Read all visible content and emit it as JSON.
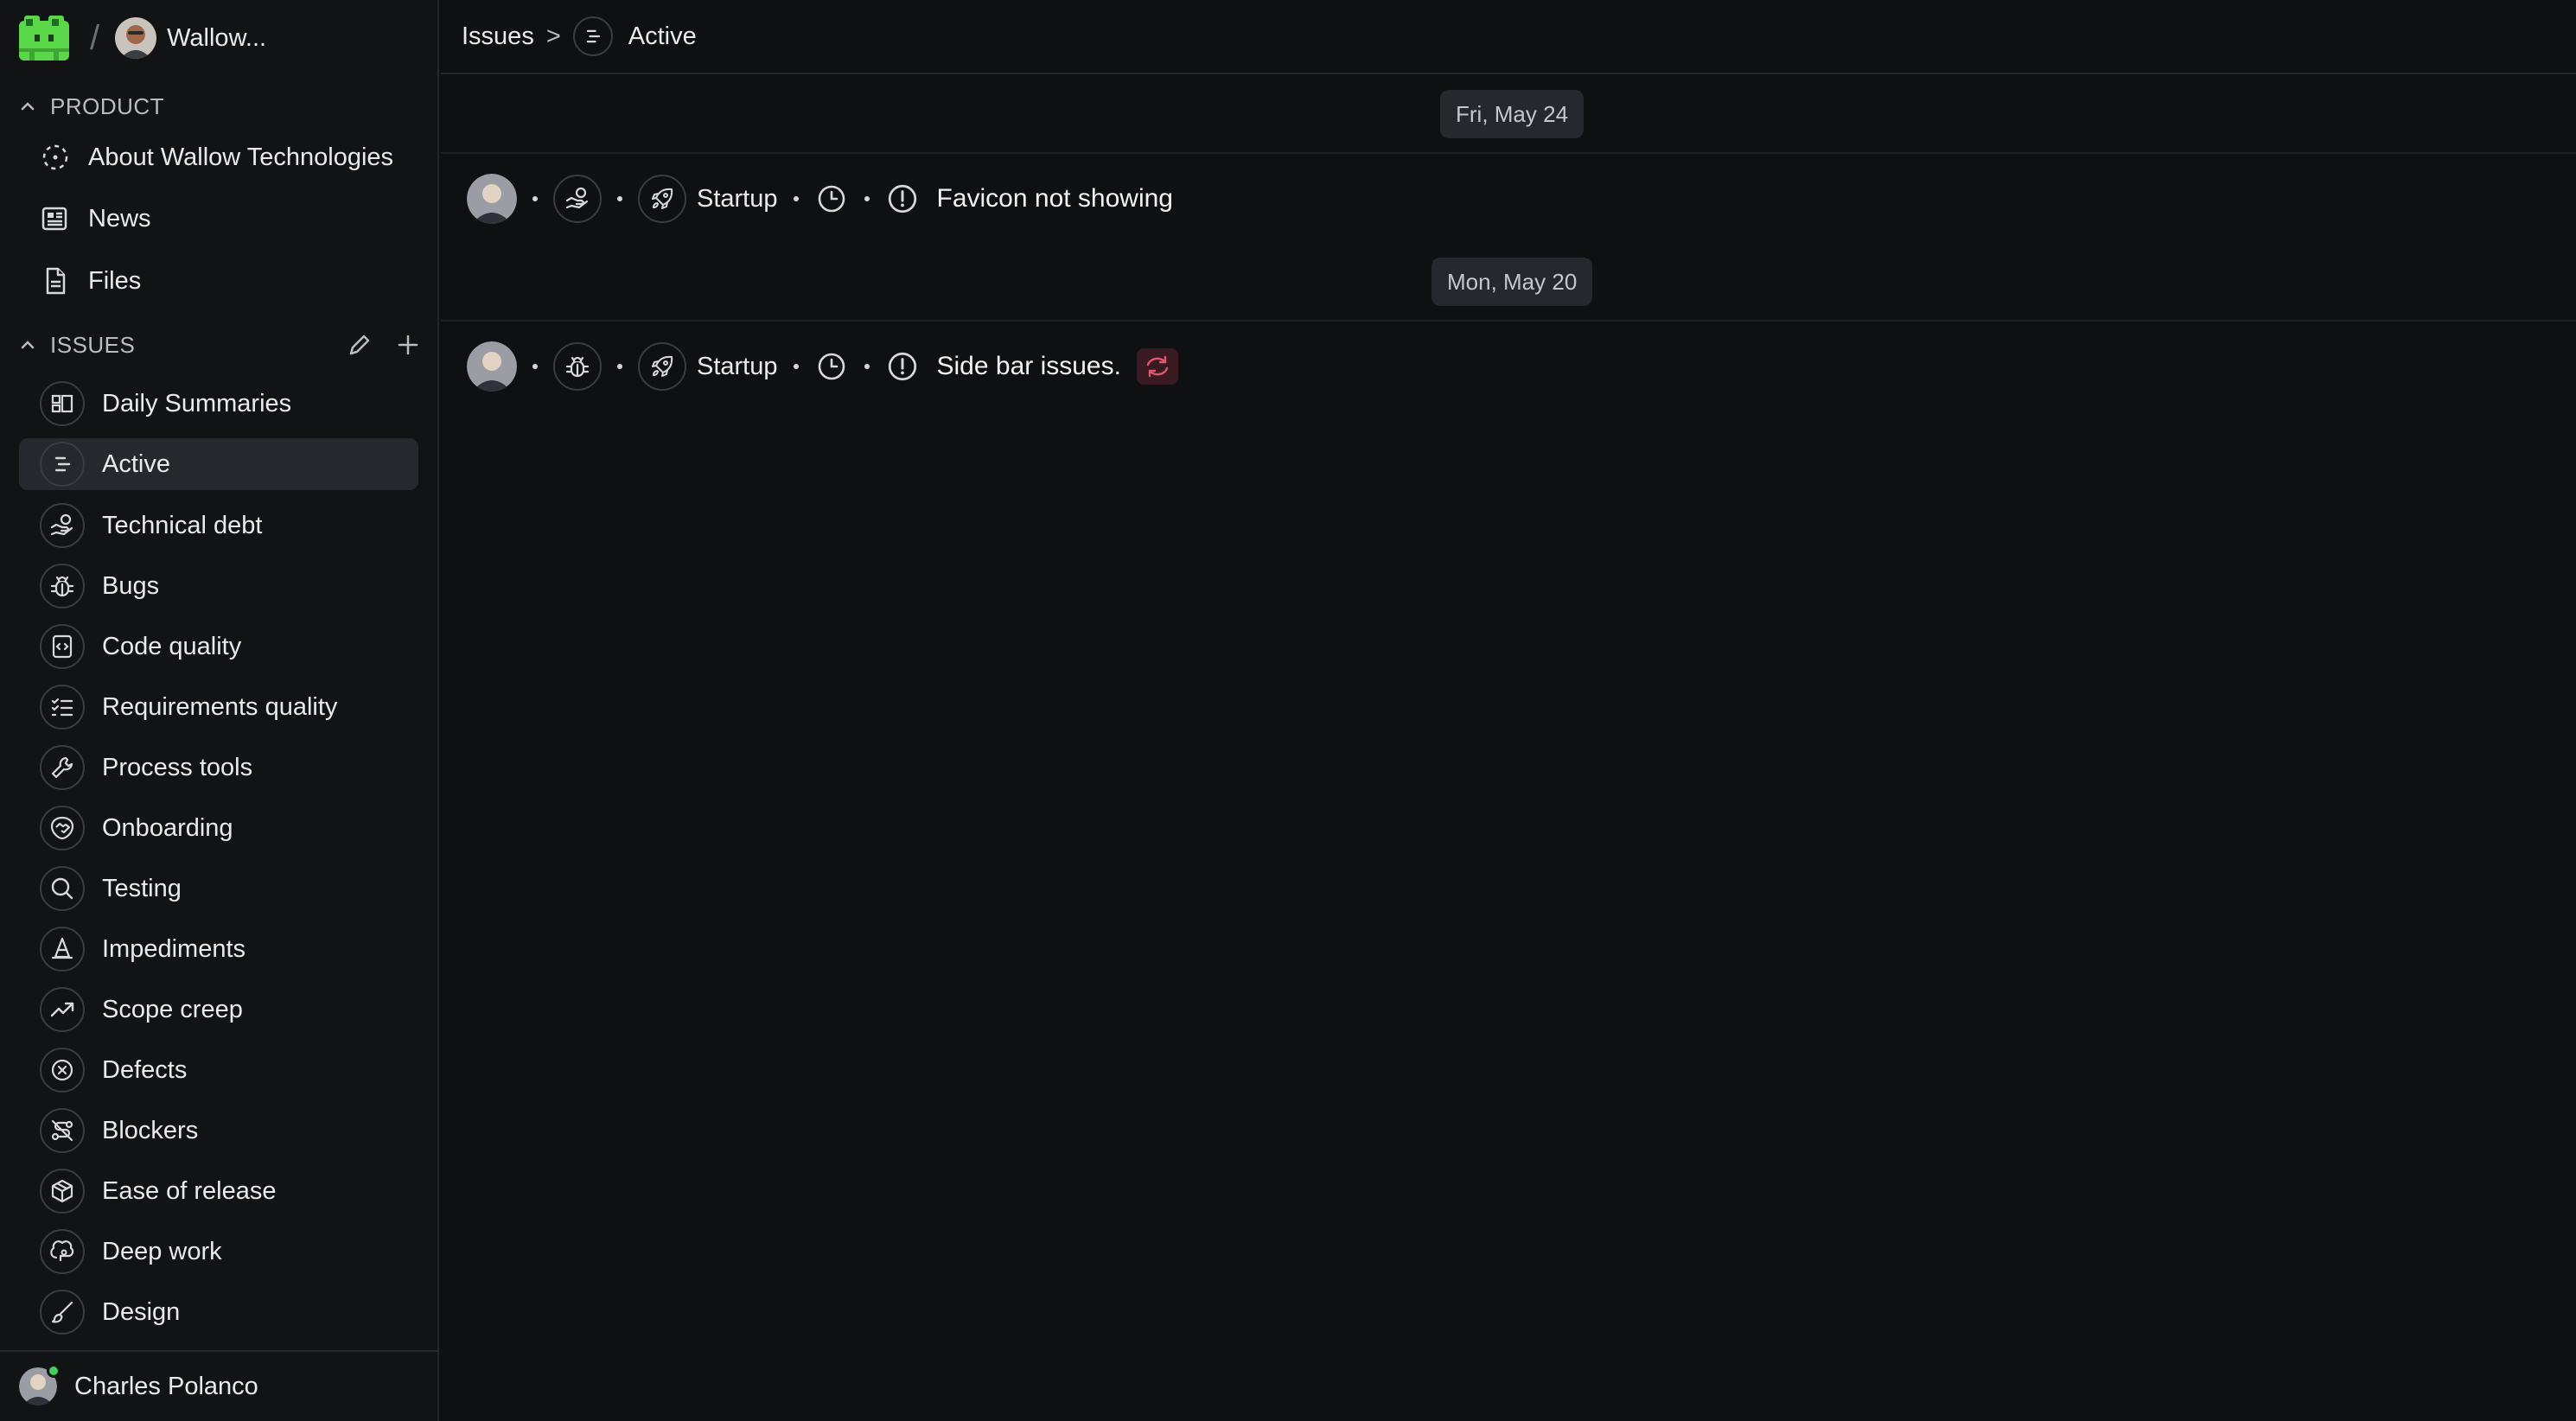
{
  "workspace": {
    "name": "Wallow..."
  },
  "sidebar": {
    "product_section": {
      "label": "PRODUCT",
      "items": [
        {
          "label": "About Wallow Technologies",
          "icon": "dashed-circle-icon"
        },
        {
          "label": "News",
          "icon": "newspaper-icon"
        },
        {
          "label": "Files",
          "icon": "file-icon"
        }
      ]
    },
    "issues_section": {
      "label": "ISSUES",
      "items": [
        {
          "label": "Daily Summaries",
          "icon": "layout-icon"
        },
        {
          "label": "Active",
          "icon": "list-icon",
          "active": true
        },
        {
          "label": "Technical debt",
          "icon": "hand-coins-icon"
        },
        {
          "label": "Bugs",
          "icon": "bug-icon"
        },
        {
          "label": "Code quality",
          "icon": "code-file-icon"
        },
        {
          "label": "Requirements quality",
          "icon": "checklist-icon"
        },
        {
          "label": "Process tools",
          "icon": "wrench-icon"
        },
        {
          "label": "Onboarding",
          "icon": "handshake-icon"
        },
        {
          "label": "Testing",
          "icon": "search-icon"
        },
        {
          "label": "Impediments",
          "icon": "cone-icon"
        },
        {
          "label": "Scope creep",
          "icon": "trending-up-icon"
        },
        {
          "label": "Defects",
          "icon": "x-circle-icon"
        },
        {
          "label": "Blockers",
          "icon": "route-off-icon"
        },
        {
          "label": "Ease of release",
          "icon": "package-icon"
        },
        {
          "label": "Deep work",
          "icon": "brain-icon"
        },
        {
          "label": "Design",
          "icon": "brush-icon"
        }
      ]
    },
    "user": {
      "name": "Charles Polanco",
      "status_color": "#3fcf5a"
    }
  },
  "breadcrumb": {
    "root": "Issues",
    "separator": ">",
    "current": "Active"
  },
  "groups": [
    {
      "date": "Fri, May 24",
      "issues": [
        {
          "category_icon": "hand-coins-icon",
          "project": "Startup",
          "title": "Favicon not showing",
          "has_sync_badge": false
        }
      ]
    },
    {
      "date": "Mon, May 20",
      "issues": [
        {
          "category_icon": "bug-icon",
          "project": "Startup",
          "title": "Side bar issues.",
          "has_sync_badge": true
        }
      ]
    }
  ],
  "colors": {
    "background": "#0f1012",
    "sidebar": "#121315",
    "active_item": "#26282d",
    "logo_green": "#5ad84a",
    "sync_badge": "#e0566e"
  }
}
